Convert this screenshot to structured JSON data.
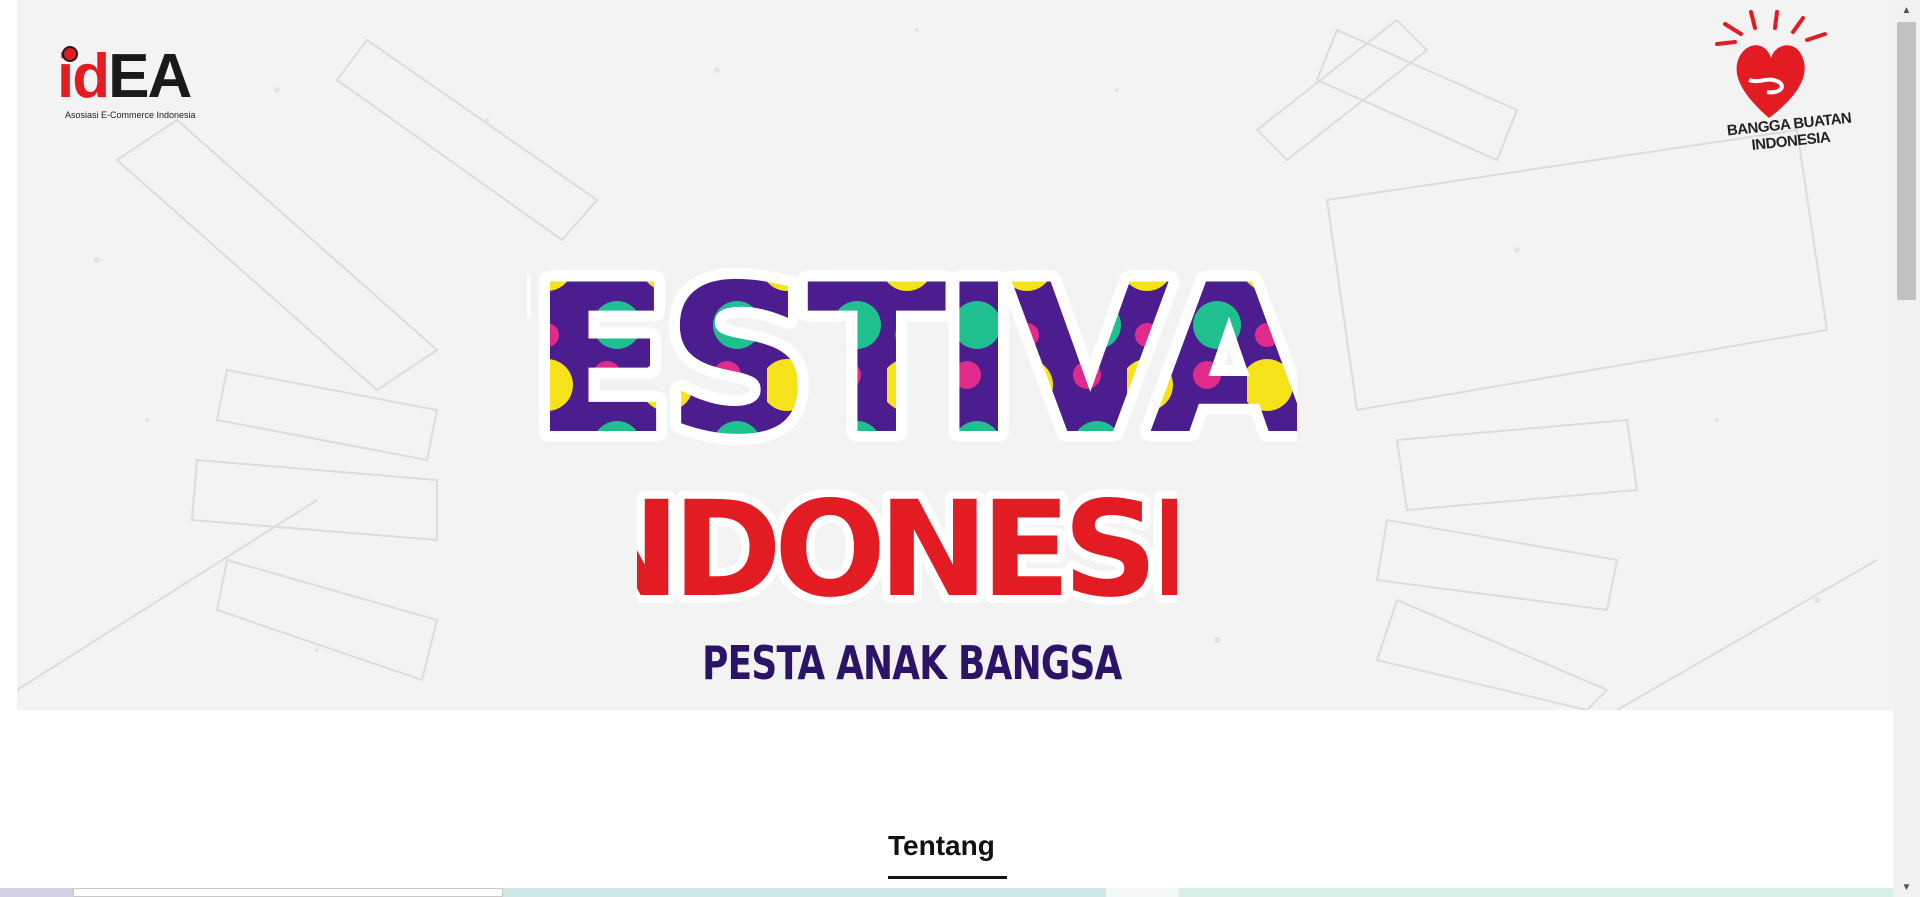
{
  "hero": {
    "idea_logo": {
      "word_id": "id",
      "word_ea": "EA",
      "tagline": "Asosiasi E-Commerce Indonesia"
    },
    "bbi_logo": {
      "line1": "BANGGA BUATAN",
      "line2": "INDONESIA"
    },
    "festival_logo": {
      "word1": "FESTIVAL",
      "word2": "INDONESIA",
      "tagline": "PESTA ANAK BANGSA"
    }
  },
  "about": {
    "title": "Tentang"
  },
  "colors": {
    "brand_red": "#e31b23",
    "purple": "#4b1d8f",
    "yellow": "#f5e21b",
    "green": "#1fbf8f",
    "magenta": "#e02a8c",
    "navy": "#2b1467"
  },
  "icons": [
    "idea-logo",
    "bangga-buatan-indonesia-heart-icon",
    "batik-cloud-icon",
    "scroll-up-arrow-icon",
    "scroll-down-arrow-icon"
  ]
}
